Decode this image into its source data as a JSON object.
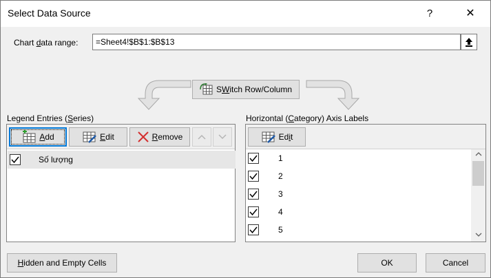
{
  "window": {
    "title": "Select Data Source",
    "help_label": "?",
    "close_label": "✕"
  },
  "range": {
    "label_pre": "Chart ",
    "label_u": "d",
    "label_post": "ata range:",
    "value": "=Sheet4!$B$1:$B$13"
  },
  "switch": {
    "label_u": "W",
    "label_pre": "S",
    "label_post": "itch Row/Column"
  },
  "legend": {
    "label_pre": "Legend Entries (",
    "label_u": "S",
    "label_post": "eries)",
    "add_u": "A",
    "add_post": "dd",
    "edit_u": "E",
    "edit_post": "dit",
    "remove_u": "R",
    "remove_post": "emove",
    "series": [
      {
        "name": "Số lượng",
        "checked": true
      }
    ]
  },
  "axis": {
    "label_pre": "Horizontal (",
    "label_u": "C",
    "label_post": "ategory) Axis Labels",
    "edit_pre": "Ed",
    "edit_u": "i",
    "edit_post": "t",
    "items": [
      "1",
      "2",
      "3",
      "4",
      "5"
    ]
  },
  "buttons": {
    "hidden_u": "H",
    "hidden_post": "idden and Empty Cells",
    "ok": "OK",
    "cancel": "Cancel"
  },
  "colors": {
    "focus_blue": "#0078d7",
    "remove_red": "#d32f2f",
    "selected_row": "#e6e6e6"
  }
}
